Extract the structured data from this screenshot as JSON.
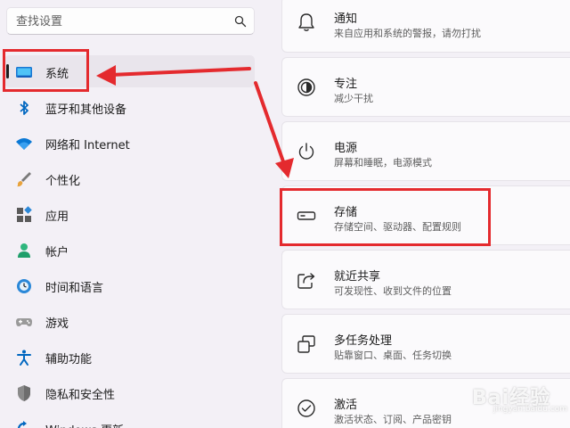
{
  "search": {
    "placeholder": "查找设置",
    "icon": "search-icon"
  },
  "nav": {
    "items": [
      {
        "label": "系统",
        "icon": "system-display-icon",
        "selected": true
      },
      {
        "label": "蓝牙和其他设备",
        "icon": "bluetooth-icon"
      },
      {
        "label": "网络和 Internet",
        "icon": "wifi-icon"
      },
      {
        "label": "个性化",
        "icon": "brush-icon"
      },
      {
        "label": "应用",
        "icon": "apps-icon"
      },
      {
        "label": "帐户",
        "icon": "account-icon"
      },
      {
        "label": "时间和语言",
        "icon": "globe-clock-icon"
      },
      {
        "label": "游戏",
        "icon": "gamepad-icon"
      },
      {
        "label": "辅助功能",
        "icon": "accessibility-icon"
      },
      {
        "label": "隐私和安全性",
        "icon": "shield-icon"
      },
      {
        "label": "Windows 更新",
        "icon": "windows-update-icon"
      }
    ]
  },
  "settings": {
    "items": [
      {
        "title": "通知",
        "description": "来自应用和系统的警报，请勿打扰",
        "icon": "bell-icon"
      },
      {
        "title": "专注",
        "description": "减少干扰",
        "icon": "focus-icon"
      },
      {
        "title": "电源",
        "description": "屏幕和睡眠，电源模式",
        "icon": "power-icon"
      },
      {
        "title": "存储",
        "description": "存储空间、驱动器、配置规则",
        "icon": "storage-drive-icon"
      },
      {
        "title": "就近共享",
        "description": "可发现性、收到文件的位置",
        "icon": "share-icon"
      },
      {
        "title": "多任务处理",
        "description": "贴靠窗口、桌面、任务切换",
        "icon": "multitasking-icon"
      },
      {
        "title": "激活",
        "description": "激活状态、订阅、产品密钥",
        "icon": "activation-check-icon"
      }
    ]
  },
  "colors": {
    "accent": "#0067c0",
    "annotation": "#e42a2e",
    "background": "#f3f0f6",
    "card": "#fbfafc"
  },
  "watermark": {
    "text": "Bai经验",
    "sub": "jingyan.baidu.com"
  }
}
